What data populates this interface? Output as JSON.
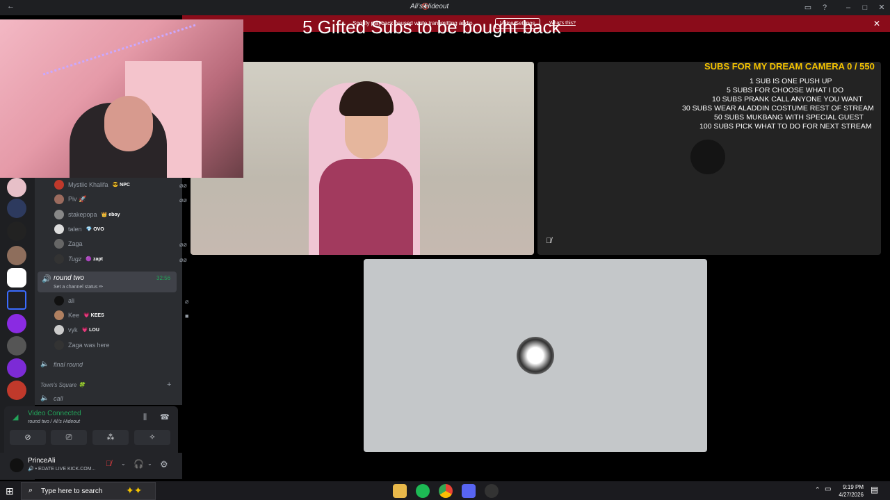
{
  "window": {
    "title": "Ali's Hideout"
  },
  "notice": {
    "message": "Spotify playback paused while transmitting audio.",
    "button": "Voice Settings",
    "link": "What's this?"
  },
  "overlay_title": "5 Gifted Subs to be bought back",
  "subs": {
    "title": "SUBS FOR MY DREAM CAMERA 0 / 550",
    "lines": [
      "1 SUB IS ONE PUSH UP",
      "5 SUBS FOR CHOOSE WHAT I DO",
      "10 SUBS PRANK CALL ANYONE YOU WANT",
      "30 SUBS WEAR ALADDIN COSTUME REST OF STREAM",
      "50 SUBS MUKBANG WITH SPECIAL GUEST",
      "100 SUBS PICK WHAT TO DO FOR NEXT STREAM"
    ]
  },
  "members_top": [
    {
      "name": "Mystiic Khalifa",
      "tag": "😎 NPC"
    },
    {
      "name": "Piv 🚀",
      "tag": ""
    },
    {
      "name": "stakepopa",
      "tag": "👑 eboy"
    },
    {
      "name": "talen",
      "tag": "💎 OVO"
    },
    {
      "name": "Zaga",
      "tag": ""
    },
    {
      "name": "Tugz",
      "tag": "🟣 zapt"
    }
  ],
  "active_channel": {
    "name": "round two",
    "status": "Set a channel status ✏",
    "time": "32:56"
  },
  "members_round_two": [
    {
      "name": "ali",
      "tag": ""
    },
    {
      "name": "Kee",
      "tag": "💗 KEES"
    },
    {
      "name": "vyk",
      "tag": "💗 LOU"
    },
    {
      "name": "Zaga was here",
      "tag": ""
    }
  ],
  "channels": {
    "final_round": "final round",
    "category": "Town's Square 🍀",
    "call": "call"
  },
  "voice_panel": {
    "status": "Video Connected",
    "location": "round two / Ali's Hideout"
  },
  "user": {
    "name": "PrinceAli",
    "status": "🔊 • EDATE LIVE KICK.COM..."
  },
  "taskbar": {
    "search_placeholder": "Type here to search",
    "time": "9:19 PM",
    "date": "4/27/2026"
  }
}
